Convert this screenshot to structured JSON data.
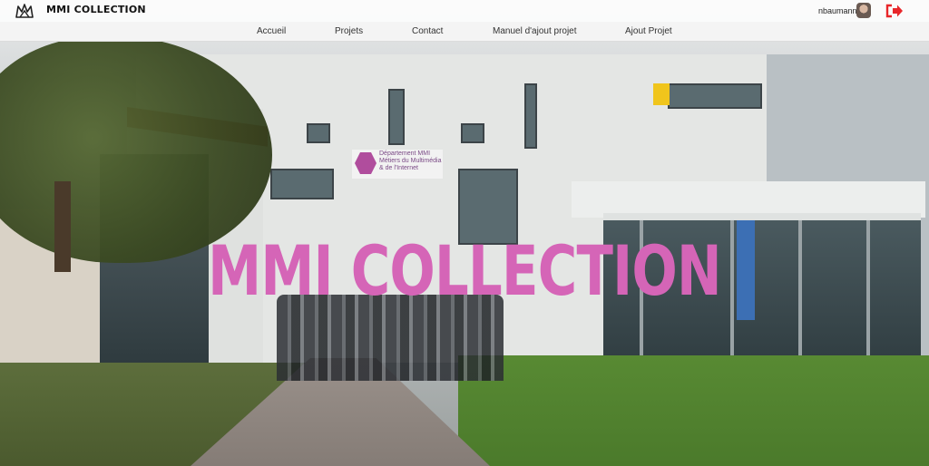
{
  "header": {
    "brand": "MMI COLLECTION",
    "logo_icon": "mmi-crown-logo-icon",
    "user": {
      "name": "nbaumann",
      "avatar_icon": "user-avatar"
    },
    "logout_icon": "logout-icon",
    "accent_color": "#e8262a"
  },
  "nav": {
    "items": [
      {
        "label": "Accueil"
      },
      {
        "label": "Projets"
      },
      {
        "label": "Contact"
      },
      {
        "label": "Manuel d'ajout projet"
      },
      {
        "label": "Ajout Projet"
      }
    ]
  },
  "hero": {
    "title": "MMI COLLECTION",
    "title_color": "#d565b7",
    "sign": {
      "line1": "Département MMI",
      "line2": "Métiers du Multimédia",
      "line3": "& de l'Internet"
    }
  }
}
